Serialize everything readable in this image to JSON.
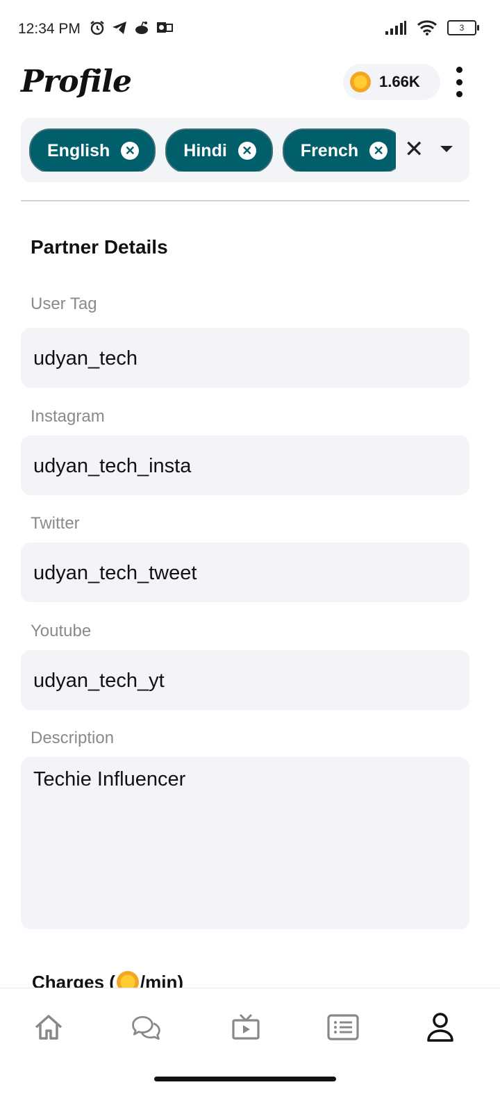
{
  "status_bar": {
    "time": "12:34 PM",
    "battery": "3",
    "left_icons": [
      "alarm-icon",
      "telegram-icon",
      "reddit-icon",
      "outlook-icon"
    ],
    "right_icons": [
      "signal-icon",
      "wifi-icon",
      "battery-icon"
    ]
  },
  "header": {
    "title": "Profile",
    "coins": "1.66K",
    "coin_icon": "coin-icon",
    "menu_icon": "more-vert-icon"
  },
  "languages": {
    "selected": [
      "English",
      "Hindi",
      "French"
    ],
    "clear_icon": "close-icon",
    "dropdown_icon": "arrow-drop-down-icon"
  },
  "section": {
    "title": "Partner Details"
  },
  "fields": {
    "user_tag": {
      "label": "User Tag",
      "value": "udyan_tech"
    },
    "instagram": {
      "label": "Instagram",
      "value": "udyan_tech_insta"
    },
    "twitter": {
      "label": "Twitter",
      "value": "udyan_tech_tweet"
    },
    "youtube": {
      "label": "Youtube",
      "value": "udyan_tech_yt"
    },
    "description": {
      "label": "Description",
      "value": "Techie Influencer"
    }
  },
  "charges": {
    "prefix": "Charges (",
    "suffix": "/min)"
  },
  "bottom_nav": {
    "items": [
      "home-icon",
      "chat-icon",
      "live-tv-icon",
      "list-icon",
      "profile-icon"
    ],
    "active": "profile-icon"
  },
  "colors": {
    "chip_bg": "#005f6b",
    "field_bg": "#f3f4f8",
    "coin": "#f5a524"
  }
}
